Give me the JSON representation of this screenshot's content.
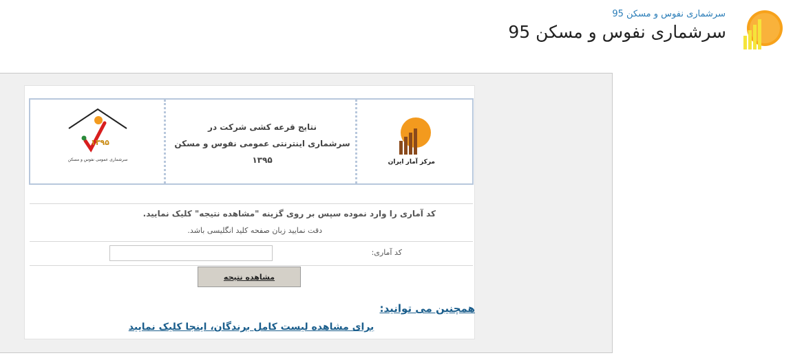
{
  "header": {
    "subtitle": "سرشماری نفوس و مسکن 95",
    "title": "سرشماری نفوس و مسکن 95",
    "logo_icon": "bar-chart-sun-logo"
  },
  "banner": {
    "line1": "نتایج قرعه کشی شرکت در",
    "line2": "سرشماری اینترنتی عمومی نفوس و مسکن",
    "line3": "۱۳۹۵",
    "left_logo_icon": "census-house-logo",
    "left_logo_number": "۱۳۹۵",
    "left_logo_caption": "سرشماری عمومی نفوس و مسکن",
    "right_logo_icon": "statistical-center-logo",
    "right_logo_caption": "مرکز آمار ایران"
  },
  "form": {
    "instruction_main": "کد آماری را وارد نموده سپس بر روی گزینه \"مشاهده نتیجه\" کلیک نمایید.",
    "instruction_note": "دقت نمایید زبان صفحه کلید انگلیسی باشد.",
    "code_label": "کد آماری:",
    "code_value": "",
    "submit_label": "مشاهده نتیجه"
  },
  "more": {
    "heading": "همچنین می توانید:",
    "winners_link": "برای مشاهده لیست کامل برندگان، اینجا کلیک نمایید"
  },
  "colors": {
    "accent_orange": "#f39a1e",
    "link_blue": "#1b5e8c",
    "banner_border": "#b7c7dc"
  }
}
